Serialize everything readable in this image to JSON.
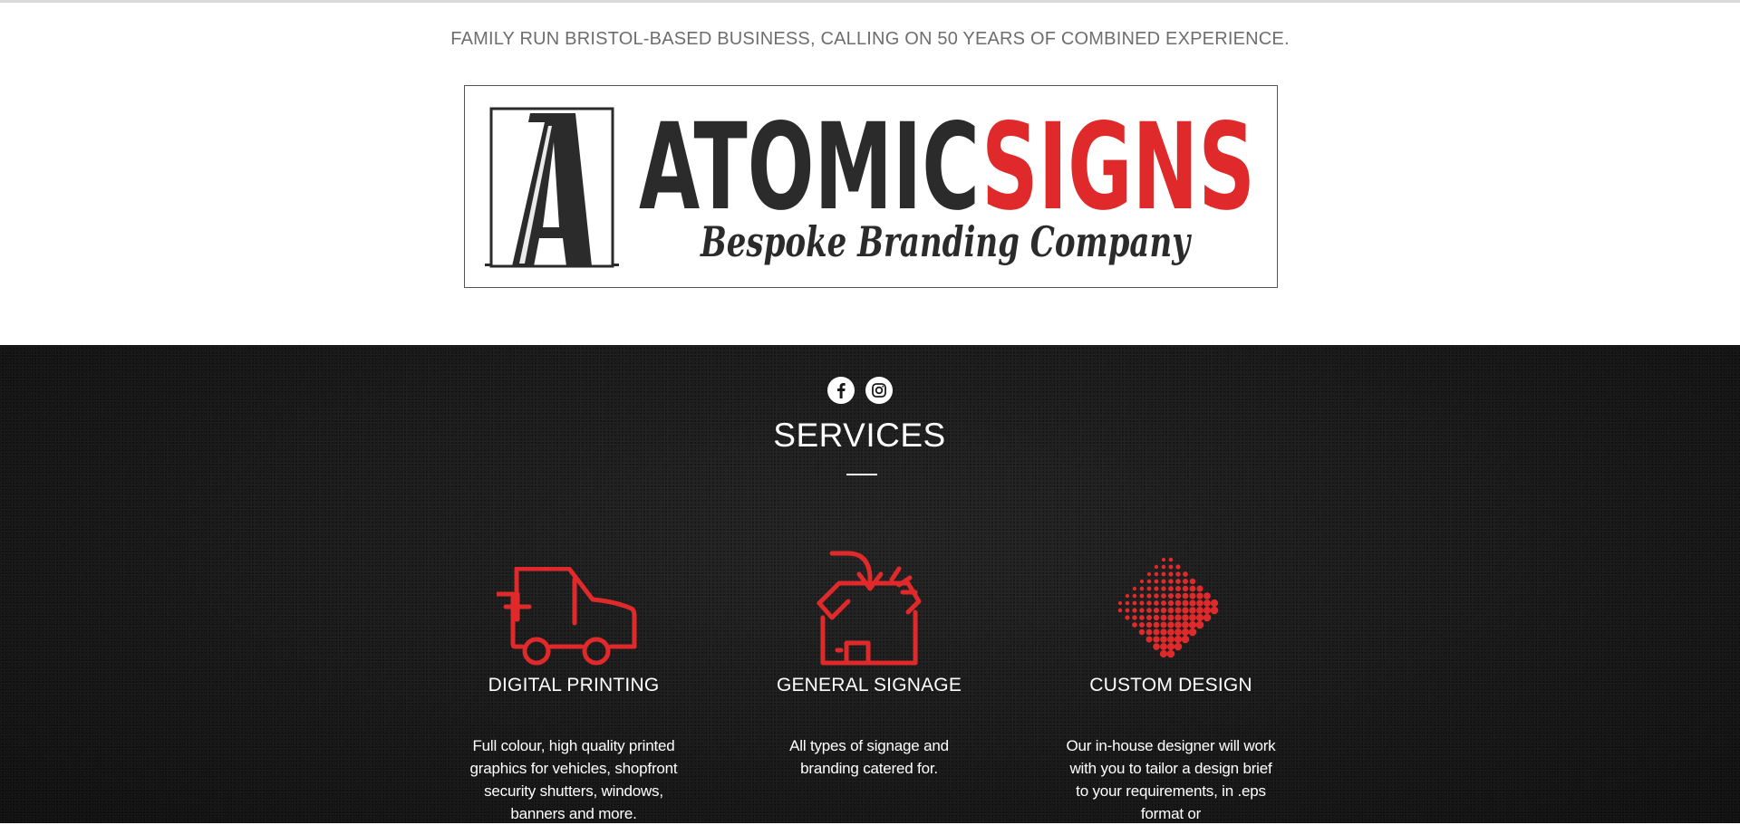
{
  "header": {
    "tagline": "FAMILY RUN BRISTOL-BASED BUSINESS, CALLING ON 50 YEARS OF COMBINED EXPERIENCE.",
    "logo": {
      "letter": "A",
      "word_dark": "ATOMIC",
      "word_red": "SIGNS",
      "subtitle": "Bespoke Branding Company",
      "colors": {
        "dark": "#2b2b2b",
        "red": "#e0292a"
      }
    }
  },
  "social": [
    {
      "name": "facebook-icon",
      "glyph": "f"
    },
    {
      "name": "instagram-icon"
    }
  ],
  "services": {
    "title": "SERVICES",
    "accent": "#e0292a",
    "items": [
      {
        "icon": "van-icon",
        "title": "DIGITAL PRINTING",
        "description": "Full colour, high quality printed graphics for vehicles, shopfront security shutters, windows, banners and more."
      },
      {
        "icon": "shop-box-icon",
        "title": "GENERAL SIGNAGE",
        "description": "All types of signage and branding catered for."
      },
      {
        "icon": "halftone-diamond-icon",
        "title": "CUSTOM DESIGN",
        "description": "Our in-house designer will work with you to tailor a design brief to your requirements, in .eps format or"
      }
    ]
  }
}
